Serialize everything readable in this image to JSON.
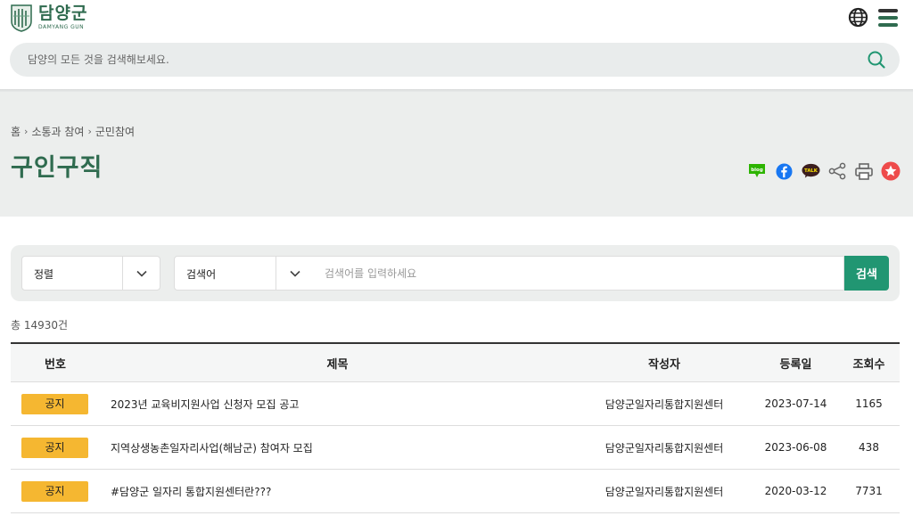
{
  "header": {
    "logo_ko": "담양군",
    "logo_en": "DAMYANG GUN",
    "search_placeholder": "담양의 모든 것을 검색해보세요."
  },
  "breadcrumb": [
    "홈",
    "소통과 참여",
    "군민참여"
  ],
  "page_title": "구인구직",
  "share_tools": [
    "blog-icon",
    "facebook-icon",
    "kakaotalk-icon",
    "share-icon",
    "print-icon",
    "favorite-icon"
  ],
  "share_labels": {
    "blog": "blog",
    "talk": "TALK"
  },
  "filter": {
    "sort_label": "정렬",
    "field_label": "검색어",
    "keyword_placeholder": "검색어를 입력하세요",
    "submit_label": "검색"
  },
  "total_count": "총 14930건",
  "table": {
    "headers": {
      "no": "번호",
      "title": "제목",
      "writer": "작성자",
      "date": "등록일",
      "views": "조회수"
    },
    "rows": [
      {
        "badge": "공지",
        "title": "2023년 교육비지원사업 신청자 모집 공고",
        "writer": "담양군일자리통합지원센터",
        "date": "2023-07-14",
        "views": "1165"
      },
      {
        "badge": "공지",
        "title": "지역상생농촌일자리사업(해남군) 참여자 모집",
        "writer": "담양군일자리통합지원센터",
        "date": "2023-06-08",
        "views": "438"
      },
      {
        "badge": "공지",
        "title": "#담양군 일자리 통합지원센터란???",
        "writer": "담양군일자리통합지원센터",
        "date": "2020-03-12",
        "views": "7731"
      }
    ]
  },
  "colors": {
    "brand_green": "#2f6b4f",
    "button_green": "#219672",
    "badge_yellow": "#f5b731"
  }
}
